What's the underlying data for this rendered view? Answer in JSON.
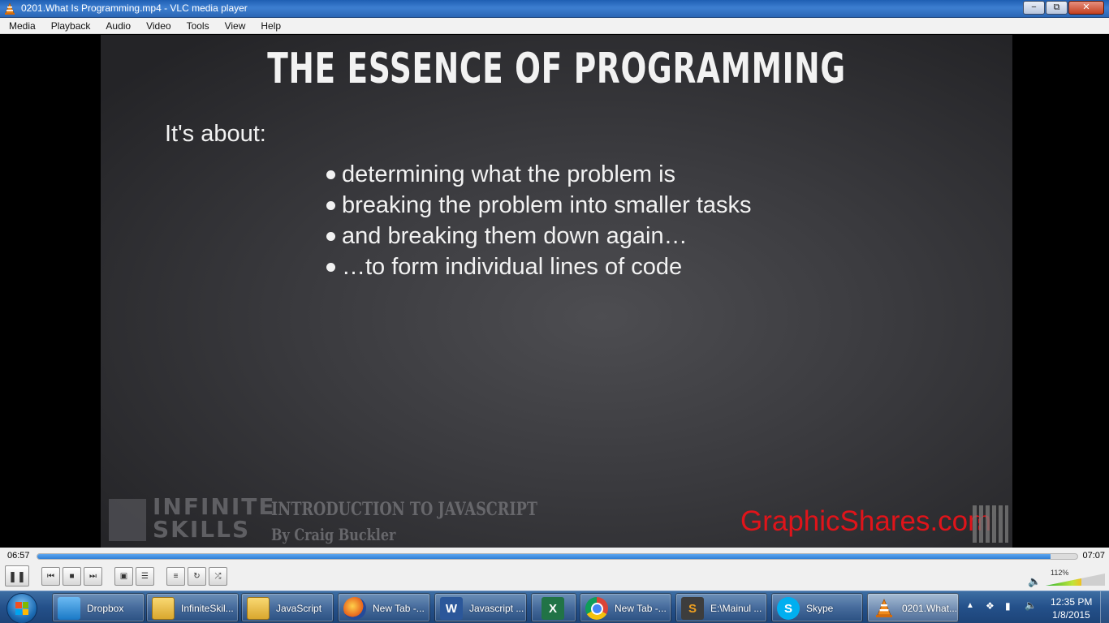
{
  "window": {
    "title": "0201.What Is Programming.mp4 - VLC media player",
    "minimize_glyph": "−",
    "maximize_glyph": "⧉",
    "close_glyph": "✕"
  },
  "menu": [
    "Media",
    "Playback",
    "Audio",
    "Video",
    "Tools",
    "View",
    "Help"
  ],
  "slide": {
    "title": "THE ESSENCE OF PROGRAMMING",
    "intro": "It's about:",
    "bullets": [
      "determining what the problem is",
      "breaking the problem into smaller tasks",
      "and breaking them down again…",
      "…to form individual lines of code"
    ],
    "brand_line1": "INFINITE",
    "brand_line2": "SKILLS",
    "course_title": "INTRODUCTION TO JAVASCRIPT",
    "course_author": "By Craig Buckler",
    "watermark": "GraphicShares.com"
  },
  "player": {
    "elapsed": "06:57",
    "total": "07:07",
    "progress": 0.974,
    "volume_label": "112%",
    "volume_fraction": 0.6,
    "controls": {
      "play_pause": "pause-icon",
      "prev": "previous-icon",
      "stop": "stop-icon",
      "next": "next-icon",
      "fullscreen": "fullscreen-icon",
      "extended": "equalizer-icon",
      "playlist": "playlist-icon",
      "loop": "loop-icon",
      "shuffle": "shuffle-icon"
    }
  },
  "taskbar": {
    "start_icon": "windows-start-icon",
    "items": [
      {
        "label": "Dropbox",
        "icon": "dropbox-folder-icon"
      },
      {
        "label": "InfiniteSkil...",
        "icon": "folder-icon"
      },
      {
        "label": "JavaScript",
        "icon": "folder-icon"
      },
      {
        "label": "New Tab -...",
        "icon": "firefox-icon"
      },
      {
        "label": "Javascript ...",
        "icon": "word-icon"
      },
      {
        "label": "",
        "icon": "excel-icon"
      },
      {
        "label": "New Tab -...",
        "icon": "chrome-icon"
      },
      {
        "label": "E:\\Mainul ...",
        "icon": "sublime-text-icon"
      },
      {
        "label": "Skype",
        "icon": "skype-icon"
      },
      {
        "label": "0201.What...",
        "icon": "vlc-icon"
      }
    ],
    "clock_time": "12:35 PM",
    "clock_date": "1/8/2015",
    "colors": {
      "accent": "#2f7fd6",
      "taskbar": "#24508a"
    }
  }
}
